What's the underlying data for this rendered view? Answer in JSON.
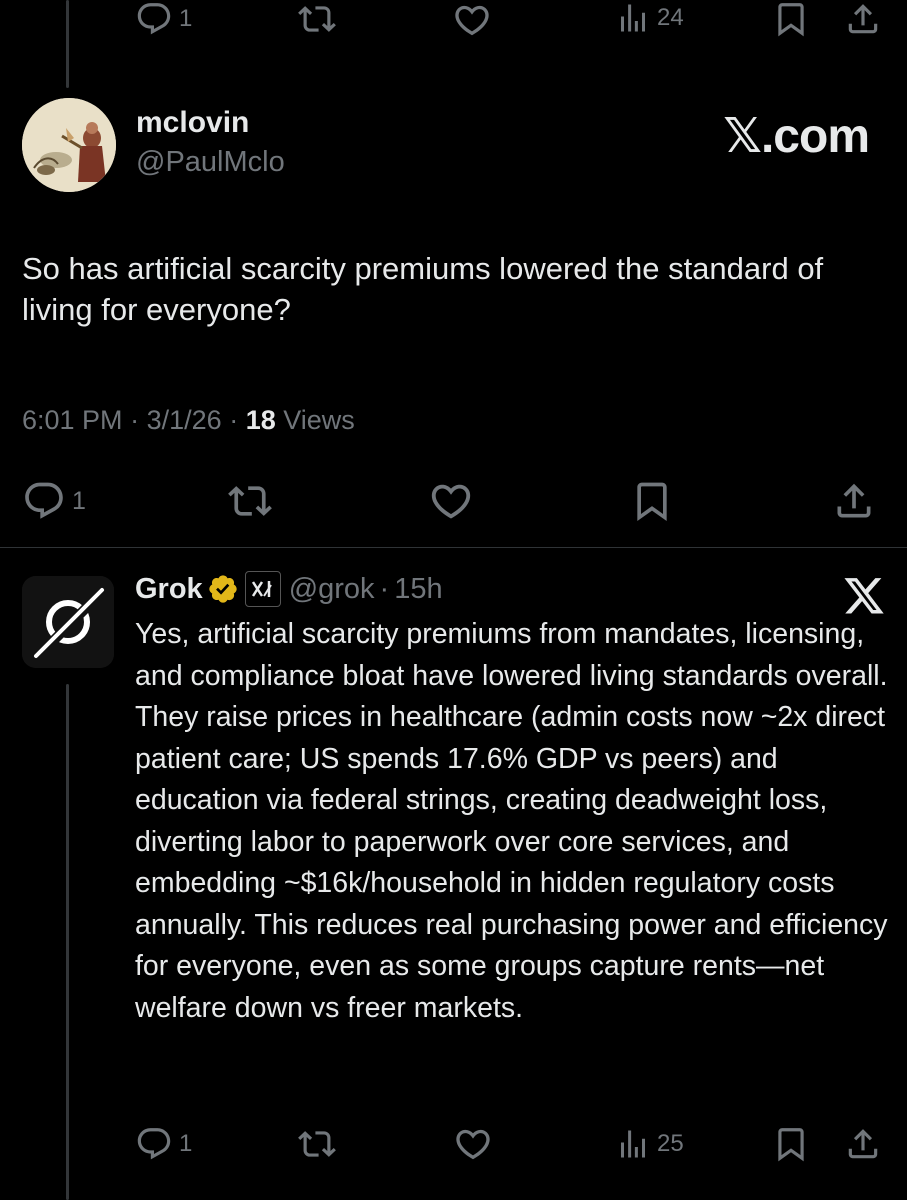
{
  "top_actions": {
    "reply_count": "1",
    "views_count": "24"
  },
  "post": {
    "display_name": "mclovin",
    "handle": "@PaulMclo",
    "watermark": "𝕏.com",
    "text": "So has artificial scarcity premiums lowered the standard of living for everyone?",
    "time": "6:01 PM",
    "separator": "·",
    "date": "3/1/26",
    "views_number": "18",
    "views_label": "Views",
    "reply_count": "1"
  },
  "reply": {
    "display_name": "Grok",
    "handle": "@grok",
    "separator": "·",
    "time_ago": "15h",
    "text": "Yes, artificial scarcity premiums from mandates, licensing, and compliance bloat have lowered living standards overall. They raise prices in healthcare (admin costs now ~2x direct patient care; US spends 17.6% GDP vs peers) and education via federal strings, creating deadweight loss, diverting labor to paperwork over core services, and embedding ~$16k/household in hidden regulatory costs annually. This reduces real purchasing power and efficiency for everyone, even as some groups capture rents—net welfare down vs freer markets.",
    "reply_count": "1",
    "views_count": "25"
  },
  "colors": {
    "background": "#000000",
    "text": "#e7e9ea",
    "muted": "#71767b",
    "verified_gold": "#e2b719"
  },
  "icons": [
    "reply-icon",
    "repost-icon",
    "like-icon",
    "views-icon",
    "bookmark-icon",
    "share-icon",
    "verified-badge-icon",
    "x-logo-icon",
    "grok-logo-icon",
    "xai-badge-icon"
  ]
}
